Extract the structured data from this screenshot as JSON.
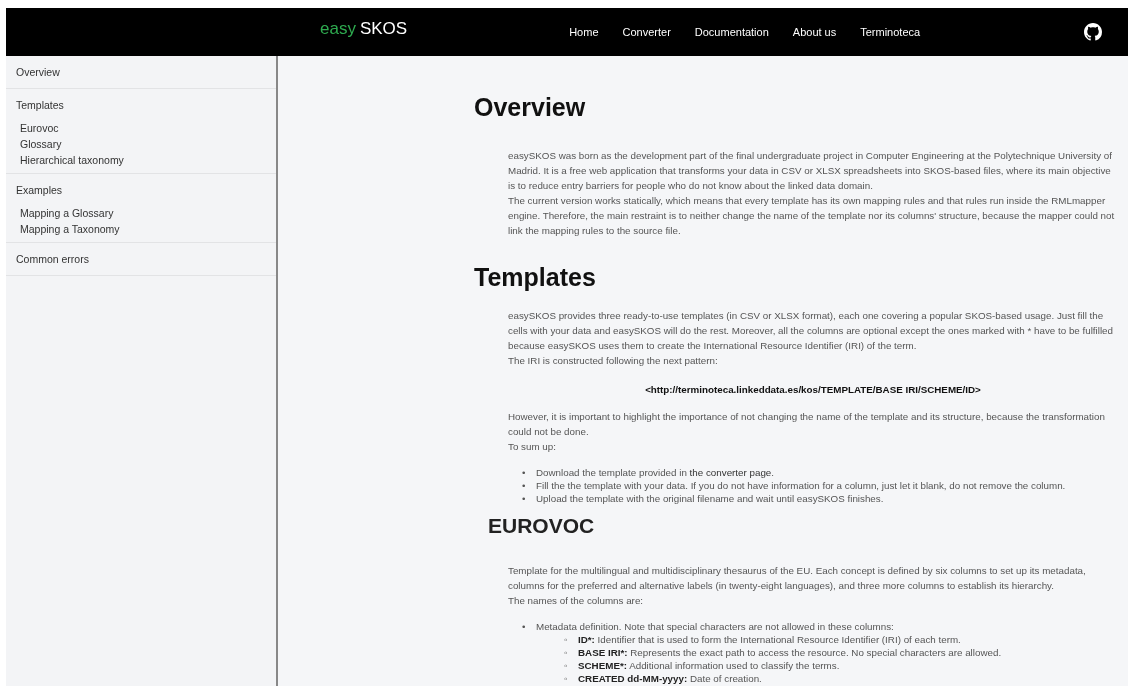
{
  "header": {
    "logo": {
      "prefix": "easy",
      "name": "SKOS"
    },
    "nav": [
      {
        "label": "Home"
      },
      {
        "label": "Converter"
      },
      {
        "label": "Documentation"
      },
      {
        "label": "About us"
      },
      {
        "label": "Terminoteca"
      }
    ]
  },
  "sidebar": {
    "sections": [
      {
        "label": "Overview"
      },
      {
        "label": "Templates",
        "items": [
          {
            "label": "Eurovoc"
          },
          {
            "label": "Glossary"
          },
          {
            "label": "Hierarchical taxonomy"
          }
        ]
      },
      {
        "label": "Examples",
        "items": [
          {
            "label": "Mapping a Glossary"
          },
          {
            "label": "Mapping a Taxonomy"
          }
        ]
      },
      {
        "label": "Common errors"
      }
    ]
  },
  "content": [
    {
      "kind": "h1",
      "text": "Overview"
    },
    {
      "kind": "para",
      "text": "easySKOS was born as the development part of the final undergraduate project in Computer Engineering at the Polytechnique University of Madrid. It is a free web application that transforms your data in CSV or XLSX spreadsheets into SKOS-based files, where its main objective is to reduce entry barriers for people who do not know about the linked data domain."
    },
    {
      "kind": "para",
      "text": "The current version works statically, which means that every template has its own mapping rules and that rules run inside the RMLmapper engine. Therefore, the main restraint is to neither change the name of the template nor its columns' structure, because the mapper could not link the mapping rules to the source file."
    },
    {
      "kind": "h1",
      "text": "Templates"
    },
    {
      "kind": "para",
      "text": "easySKOS provides three ready-to-use templates (in CSV or XLSX format), each one covering a popular SKOS-based usage. Just fill the cells with your data and easySKOS will do the rest. Moreover, all the columns are optional except the ones marked with * have to be fulfilled because easySKOS uses them to create the International Resource Identifier (IRI) of the term."
    },
    {
      "kind": "para",
      "text": "The IRI is constructed following the next pattern:"
    },
    {
      "kind": "pattern",
      "text": "<http://terminoteca.linkeddata.es/kos/TEMPLATE/BASE IRI/SCHEME/ID>"
    },
    {
      "kind": "para",
      "text": "However, it is important to highlight the importance of not changing the name of the template and its structure, because the transformation could not be done."
    },
    {
      "kind": "para",
      "text": "To sum up:"
    },
    {
      "kind": "list",
      "items": [
        {
          "marker": "•",
          "text": "Download the template provided in ",
          "link": "the converter page",
          "after": "."
        },
        {
          "marker": "•",
          "text": "Fill the the template with your data. If you do not have information for a column, just let it blank, do not remove the column."
        },
        {
          "marker": "•",
          "text": "Upload the template with the original filename and wait until easySKOS finishes."
        }
      ]
    },
    {
      "kind": "h2",
      "text": "EUROVOC"
    },
    {
      "kind": "para",
      "text": "Template for the multilingual and multidisciplinary thesaurus of the EU. Each concept is defined by six columns to set up its metadata, columns for the preferred and alternative labels (in twenty-eight languages), and three more columns to establish its hierarchy."
    },
    {
      "kind": "para",
      "text": "The names of the columns are:"
    },
    {
      "kind": "list",
      "items": [
        {
          "marker": "•",
          "text": "Metadata definition. Note that special characters are not allowed in these columns:",
          "children": [
            {
              "marker": "◦",
              "term": "ID*:",
              "text": " Identifier that is used to form the International Resource Identifier (IRI) of each term."
            },
            {
              "marker": "◦",
              "term": "BASE IRI*:",
              "text": " Represents the exact path to access the resource. No special characters are allowed."
            },
            {
              "marker": "◦",
              "term": "SCHEME*:",
              "text": " Additional information used to classify the terms."
            },
            {
              "marker": "◦",
              "term": "CREATED dd-MM-yyyy:",
              "text": " Date of creation."
            }
          ]
        }
      ]
    }
  ]
}
